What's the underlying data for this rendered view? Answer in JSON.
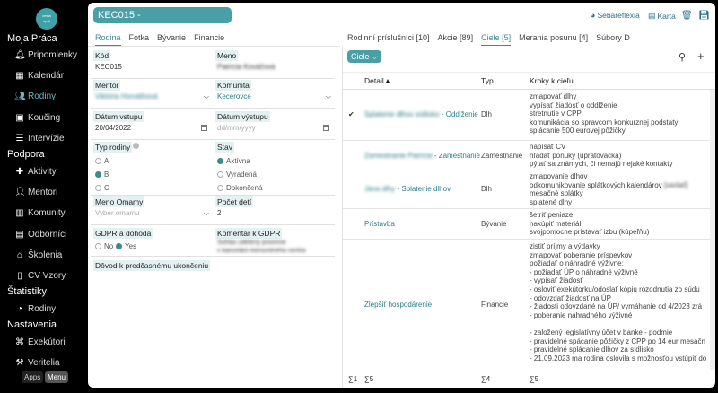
{
  "sidebar": {
    "logo": "cestaspat",
    "sections": [
      {
        "title": "Moja Práca"
      },
      {
        "title": "Podpora"
      },
      {
        "title": "Štatistiky"
      },
      {
        "title": "Nastavenia"
      }
    ],
    "items": [
      {
        "label": "Pripomienky",
        "icon": "bell-icon"
      },
      {
        "label": "Kalendár",
        "icon": "calendar-icon"
      },
      {
        "label": "Rodiny",
        "icon": "users-icon"
      },
      {
        "label": "Koučing",
        "icon": "briefcase-icon"
      },
      {
        "label": "Intervízie",
        "icon": "list-icon"
      },
      {
        "label": "Aktivity",
        "icon": "puzzle-icon"
      },
      {
        "label": "Mentori",
        "icon": "person-icon"
      },
      {
        "label": "Komunity",
        "icon": "map-icon"
      },
      {
        "label": "Odborníci",
        "icon": "badge-icon"
      },
      {
        "label": "Školenia",
        "icon": "school-icon"
      },
      {
        "label": "CV Vzory",
        "icon": "document-icon"
      },
      {
        "label": "Rodiny",
        "icon": "chart-icon"
      },
      {
        "label": "Exekútori",
        "icon": "bank-icon"
      },
      {
        "label": "Veritelia",
        "icon": "gavel-icon"
      }
    ],
    "bottom": {
      "apps": "Apps",
      "menu": "Menu"
    }
  },
  "header": {
    "title": "KEC015 -",
    "sebareflexia": "Sebareflexia",
    "karta": "Karta"
  },
  "left_tabs": [
    "Rodina",
    "Fotka",
    "Bývanie",
    "Financie"
  ],
  "form": {
    "kod": {
      "label": "Kód",
      "value": "KEC015"
    },
    "meno": {
      "label": "Meno",
      "value": "Patrícia Kováčová"
    },
    "mentor": {
      "label": "Mentor",
      "value": "Viktória Horváthová"
    },
    "komunita": {
      "label": "Komunita",
      "value": "Kecerovce"
    },
    "datum_vstupu": {
      "label": "Dátum vstupu",
      "value": "20/04/2022"
    },
    "datum_vystupu": {
      "label": "Dátum výstupu",
      "placeholder": "dd/mm/yyyy"
    },
    "typ_rodiny": {
      "label": "Typ rodiny",
      "options": [
        "A",
        "B",
        "C"
      ],
      "selected": "B"
    },
    "stav": {
      "label": "Stav",
      "options": [
        "Aktívna",
        "Vyradená",
        "Dokončená"
      ],
      "selected": "Aktívna"
    },
    "meno_omamy": {
      "label": "Meno Omamy",
      "placeholder": "Vyber omamu"
    },
    "pocet_deti": {
      "label": "Počet detí",
      "value": "2"
    },
    "gdpr": {
      "label": "GDPR a dohoda",
      "no": "No",
      "yes": "Yes"
    },
    "gdpr_komentar": {
      "label": "Komentár k GDPR",
      "line1": "Súhlas udelený písomne",
      "line2": "v kancelárii komunitného centra"
    },
    "dovod": {
      "label": "Dôvod k predčasnému ukončeniu"
    }
  },
  "right_tabs": [
    "Rodinní príslušníci [10]",
    "Akcie [89]",
    "Ciele [5]",
    "Merania posunu [4]",
    "Súbory D"
  ],
  "list": {
    "filter": "Ciele",
    "columns": {
      "detail": "Detail",
      "typ": "Typ",
      "kroky": "Kroky k cieľu"
    },
    "rows": [
      {
        "detail_blur": "Splatenie dlhov sídlisko",
        "detail": " - Oddlženie",
        "typ": "Dlh",
        "checked": true,
        "kroky": [
          "zmapovať dlhy",
          "vypísať žiadosť o oddlženie",
          "stretnutie v CPP",
          "komunikácia so spravcom konkurznej podstaty",
          "splácanie 500 eurovej pôžičky"
        ]
      },
      {
        "detail_blur": "Zamestnanie Patrícia",
        "detail": " - Zamestnanie",
        "typ": "Zamestnanie",
        "checked": false,
        "kroky": [
          "napísať CV",
          "hľadať ponuky (upratovačka)",
          "pýtať sa známych, či nemajú nejaké kontakty"
        ]
      },
      {
        "detail_blur": "Jána dlhy",
        "detail": " - Splatenie dlhov",
        "typ": "Dlh",
        "checked": false,
        "kroky": [
          "zmapovanie dlhov",
          "odkomunikovanie splátkových kalendárov",
          "mesačné splátky",
          "splatené dlhy"
        ],
        "kroky_blur": "[veriteľ]"
      },
      {
        "detail_blur": "",
        "detail": "Prístavba",
        "typ": "Bývanie",
        "checked": false,
        "kroky": [
          "šetriť peniaze,",
          "nakúpiť materiál",
          "svojpomocne pristavať izbu (kúpeľňu)"
        ]
      },
      {
        "detail_blur": "",
        "detail": "Zlepšiť hospodárenie",
        "typ": "Financie",
        "checked": false,
        "kroky": [
          "zistiť príjmy a výdavky",
          "zmapovať poberanie príspevkov",
          "požiadať o náhradné výživne:",
          "- požiadať ÚP o náhradné výživné",
          "- vypísať žiadosť",
          "- osloviť exekútorku/odoslať kópiu rozodnutia zo súdu",
          "- odovzdať žiadosť na ÚP",
          "- žiadosti odovzdané na ÚP/ vymáhanie od 4/2023 zrá",
          "- poberanie náhradného výživné",
          "",
          "- založený legislatívny účet v banke - podmie",
          "- pravidelné spácanie pôžičky z CPP po 14 eur mesačn",
          "- pravidelné splácanie dlhov za sídlisko",
          "- 21.09.2023 ma rodina oslovila s možnosťou vstúpiť do"
        ]
      }
    ],
    "footer": {
      "c1": "∑1",
      "c2": "∑5",
      "c3": "∑4",
      "c4": "∑5"
    }
  }
}
